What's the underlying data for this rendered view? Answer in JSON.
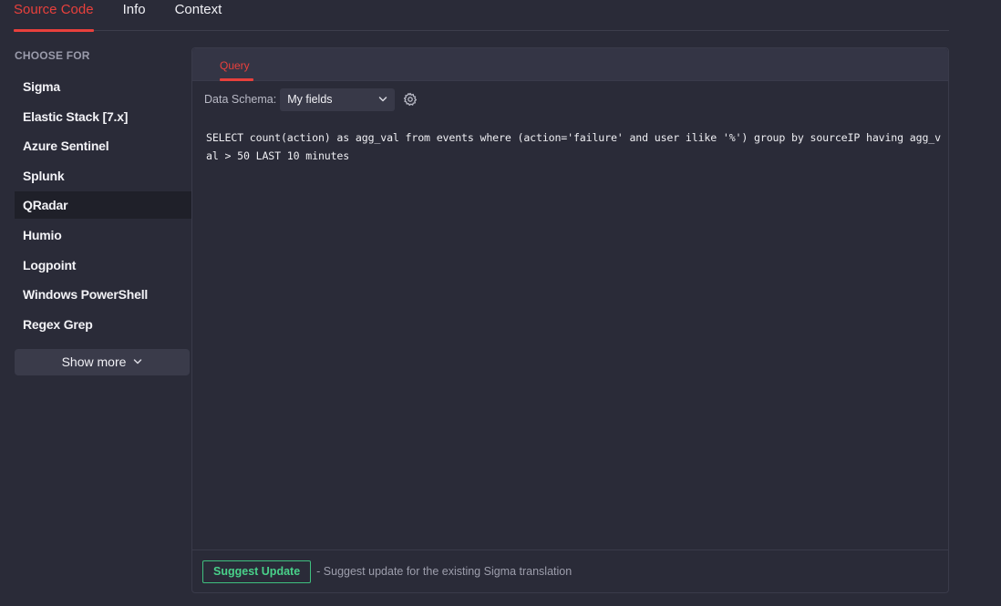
{
  "top_tabs": [
    {
      "label": "Source Code",
      "active": true
    },
    {
      "label": "Info",
      "active": false
    },
    {
      "label": "Context",
      "active": false
    }
  ],
  "sidebar": {
    "heading": "CHOOSE FOR",
    "items": [
      {
        "label": "Sigma"
      },
      {
        "label": "Elastic Stack [7.x]"
      },
      {
        "label": "Azure Sentinel"
      },
      {
        "label": "Splunk"
      },
      {
        "label": "QRadar",
        "selected": true
      },
      {
        "label": "Humio"
      },
      {
        "label": "Logpoint"
      },
      {
        "label": "Windows PowerShell"
      },
      {
        "label": "Regex Grep"
      }
    ],
    "show_more_label": "Show more",
    "show_more_icon": "chevron-down-icon"
  },
  "panel": {
    "tab_label": "Query",
    "schema_label": "Data Schema:",
    "schema_value": "My fields",
    "settings_icon": "gear-icon",
    "code": "SELECT count(action) as agg_val from events where (action='failure' and user ilike '%') group by sourceIP having agg_val > 50 LAST 10 minutes",
    "suggest_label": "Suggest Update",
    "suggest_desc": "- Suggest update for the existing Sigma translation"
  },
  "colors": {
    "accent_red": "#e8403c",
    "suggest_green": "#49d18a",
    "background": "#2a2b38"
  }
}
